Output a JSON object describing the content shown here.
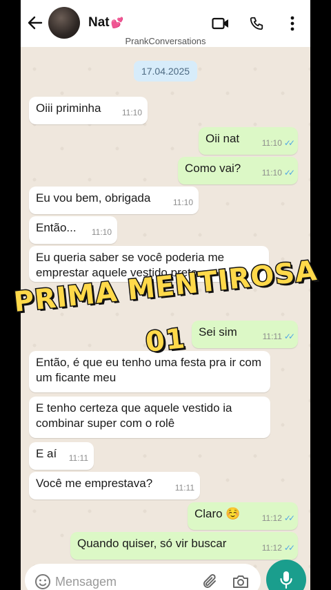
{
  "header": {
    "contact_name": "Nat",
    "name_emoji": "💕",
    "subtitle": "PrankConversations"
  },
  "icons": {
    "back": "arrow-left-icon",
    "video": "video-camera-icon",
    "call": "phone-icon",
    "menu": "vertical-dots-icon",
    "emoji": "emoji-icon",
    "attach": "paperclip-icon",
    "camera": "camera-icon",
    "mic": "microphone-icon"
  },
  "date_chip": "17.04.2025",
  "messages": [
    {
      "dir": "in",
      "text": "Oiii priminha",
      "time": "11:10"
    },
    {
      "dir": "out",
      "text": "Oii nat",
      "time": "11:10"
    },
    {
      "dir": "out",
      "text": "Como vai?",
      "time": "11:10"
    },
    {
      "dir": "in",
      "text": "Eu vou bem, obrigada",
      "time": "11:10"
    },
    {
      "dir": "in",
      "text": "Então...",
      "time": "11:10"
    },
    {
      "dir": "in",
      "text": "Eu queria saber se você poderia me emprestar aquele vestido preto",
      "time": ""
    },
    {
      "dir": "out",
      "text": "Sei sim",
      "time": "11:11"
    },
    {
      "dir": "in",
      "text": "Então, é que eu tenho uma festa pra ir com um ficante meu",
      "time": ""
    },
    {
      "dir": "in",
      "text": "E tenho certeza que aquele vestido ia combinar super com o rolê",
      "time": ""
    },
    {
      "dir": "in",
      "text": "E aí",
      "time": "11:11"
    },
    {
      "dir": "in",
      "text": "Você me emprestava?",
      "time": "11:11"
    },
    {
      "dir": "out",
      "text": "Claro ☺️",
      "time": "11:12"
    },
    {
      "dir": "out",
      "text": "Quando quiser, só vir buscar",
      "time": "11:12"
    }
  ],
  "overlay": {
    "line1": "PRIMA MENTIROSA",
    "line2": "01"
  },
  "input": {
    "placeholder": "Mensagem"
  },
  "colors": {
    "incoming": "#ffffff",
    "outgoing": "#dcf8c6",
    "accent": "#1a9e8d",
    "read_ticks": "#4fa6e6",
    "overlay_text": "#ffd94a"
  }
}
